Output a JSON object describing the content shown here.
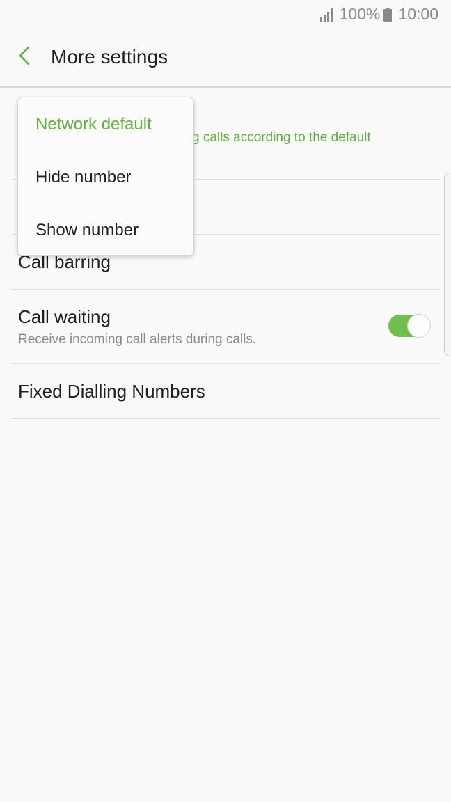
{
  "status_bar": {
    "battery_percent": "100%",
    "time": "10:00",
    "icons": [
      "signal-icon",
      "battery-icon"
    ]
  },
  "header": {
    "back_icon": "chevron-left-icon",
    "title": "More settings"
  },
  "rows": {
    "caller_id_sub_partial": "g calls according to the default",
    "call_barring": "Call barring",
    "call_waiting": {
      "title": "Call waiting",
      "subtitle": "Receive incoming call alerts during calls.",
      "enabled": true
    },
    "fixed_dialling": "Fixed Dialling Numbers"
  },
  "popup": {
    "options": [
      {
        "label": "Network default",
        "selected": true
      },
      {
        "label": "Hide number",
        "selected": false
      },
      {
        "label": "Show number",
        "selected": false
      }
    ]
  },
  "colors": {
    "accent": "#5fb041",
    "toggle_on": "#71bd4e",
    "background": "#f9f9f9",
    "text_primary": "#212121",
    "text_secondary": "#8a8a8a"
  }
}
